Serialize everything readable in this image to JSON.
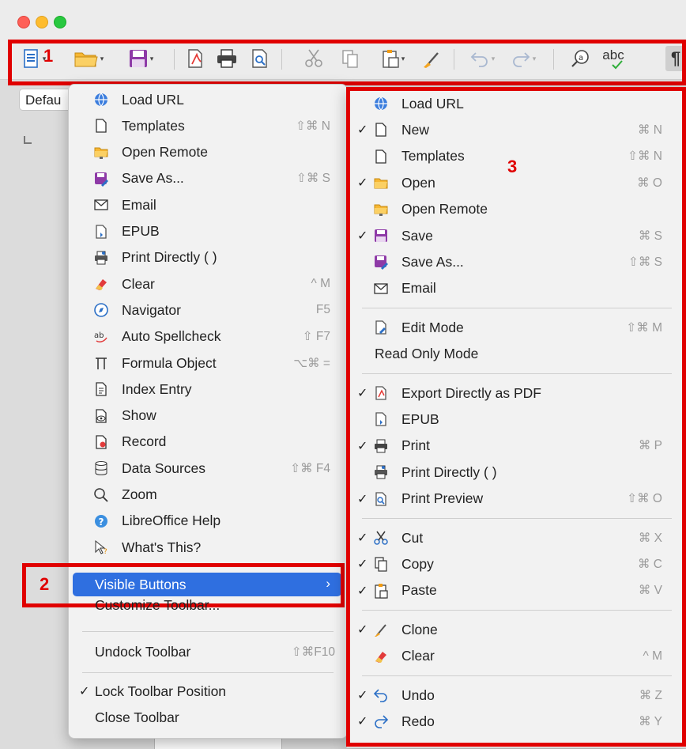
{
  "window": {
    "traffic_lights": [
      "close",
      "minimize",
      "zoom"
    ]
  },
  "annotations": {
    "one": "1",
    "two": "2",
    "three": "3"
  },
  "background": {
    "paragraph_style": "Defau"
  },
  "toolbar": {
    "icons": [
      "new-document-icon",
      "open-folder-icon",
      "save-icon",
      "export-pdf-icon",
      "print-icon",
      "print-preview-icon",
      "cut-icon",
      "copy-icon",
      "paste-icon",
      "clone-formatting-icon",
      "undo-icon",
      "redo-icon",
      "find-replace-icon",
      "spellcheck-icon",
      "formatting-marks-icon"
    ],
    "spellcheck_text": "abc",
    "pilcrow": "¶"
  },
  "context_menu": {
    "items": [
      {
        "label": "Load URL",
        "icon": "globe-icon",
        "shortcut": ""
      },
      {
        "label": "Templates",
        "icon": "document-icon",
        "shortcut": "⇧⌘ N"
      },
      {
        "label": "Open Remote",
        "icon": "remote-folder-icon",
        "shortcut": ""
      },
      {
        "label": "Save As...",
        "icon": "save-as-icon",
        "shortcut": "⇧⌘ S"
      },
      {
        "label": "Email",
        "icon": "envelope-icon",
        "shortcut": ""
      },
      {
        "label": "EPUB",
        "icon": "epub-icon",
        "shortcut": ""
      },
      {
        "label": "Print Directly ( )",
        "icon": "print-directly-icon",
        "shortcut": ""
      },
      {
        "label": "Clear",
        "icon": "eraser-icon",
        "shortcut": "^ M"
      },
      {
        "label": "Navigator",
        "icon": "compass-icon",
        "shortcut": "F5"
      },
      {
        "label": "Auto Spellcheck",
        "icon": "auto-spellcheck-icon",
        "shortcut": "⇧ F7"
      },
      {
        "label": "Formula Object",
        "icon": "formula-icon",
        "shortcut": "⌥⌘ ="
      },
      {
        "label": "Index Entry",
        "icon": "index-entry-icon",
        "shortcut": ""
      },
      {
        "label": "Show",
        "icon": "show-changes-icon",
        "shortcut": ""
      },
      {
        "label": "Record",
        "icon": "record-changes-icon",
        "shortcut": ""
      },
      {
        "label": "Data Sources",
        "icon": "database-icon",
        "shortcut": "⇧⌘ F4"
      },
      {
        "label": "Zoom",
        "icon": "magnifier-icon",
        "shortcut": ""
      },
      {
        "label": "LibreOffice Help",
        "icon": "help-icon",
        "shortcut": ""
      },
      {
        "label": "What's This?",
        "icon": "whats-this-icon",
        "shortcut": ""
      }
    ],
    "visible_buttons": "Visible Buttons",
    "customize_toolbar": "Customize Toolbar...",
    "undock_toolbar": "Undock Toolbar",
    "undock_shortcut": "⇧⌘F10",
    "lock_toolbar_position": "Lock Toolbar Position",
    "close_toolbar": "Close Toolbar"
  },
  "visible_buttons_menu": {
    "groups": [
      [
        {
          "label": "Load URL",
          "icon": "globe-icon",
          "checked": false,
          "shortcut": ""
        },
        {
          "label": "New",
          "icon": "document-icon",
          "checked": true,
          "shortcut": "⌘ N"
        },
        {
          "label": "Templates",
          "icon": "document-icon",
          "checked": false,
          "shortcut": "⇧⌘ N"
        },
        {
          "label": "Open",
          "icon": "open-folder-icon",
          "checked": true,
          "shortcut": "⌘ O"
        },
        {
          "label": "Open Remote",
          "icon": "remote-folder-icon",
          "checked": false,
          "shortcut": ""
        },
        {
          "label": "Save",
          "icon": "save-icon",
          "checked": true,
          "shortcut": "⌘ S"
        },
        {
          "label": "Save As...",
          "icon": "save-as-icon",
          "checked": false,
          "shortcut": "⇧⌘ S"
        },
        {
          "label": "Email",
          "icon": "envelope-icon",
          "checked": false,
          "shortcut": ""
        }
      ],
      [
        {
          "label": "Edit Mode",
          "icon": "edit-mode-icon",
          "checked": false,
          "shortcut": "⇧⌘ M"
        },
        {
          "label": "Read Only Mode",
          "icon": "",
          "checked": false,
          "shortcut": ""
        }
      ],
      [
        {
          "label": "Export Directly as PDF",
          "icon": "export-pdf-icon",
          "checked": true,
          "shortcut": ""
        },
        {
          "label": "EPUB",
          "icon": "epub-icon",
          "checked": false,
          "shortcut": ""
        },
        {
          "label": "Print",
          "icon": "print-icon",
          "checked": true,
          "shortcut": "⌘ P"
        },
        {
          "label": "Print Directly ( )",
          "icon": "print-directly-icon",
          "checked": false,
          "shortcut": ""
        },
        {
          "label": "Print Preview",
          "icon": "print-preview-icon",
          "checked": true,
          "shortcut": "⇧⌘ O"
        }
      ],
      [
        {
          "label": "Cut",
          "icon": "cut-icon",
          "checked": true,
          "shortcut": "⌘ X"
        },
        {
          "label": "Copy",
          "icon": "copy-icon",
          "checked": true,
          "shortcut": "⌘ C"
        },
        {
          "label": "Paste",
          "icon": "paste-icon",
          "checked": true,
          "shortcut": "⌘ V"
        }
      ],
      [
        {
          "label": "Clone",
          "icon": "clone-formatting-icon",
          "checked": true,
          "shortcut": ""
        },
        {
          "label": "Clear",
          "icon": "eraser-icon",
          "checked": false,
          "shortcut": "^ M"
        }
      ],
      [
        {
          "label": "Undo",
          "icon": "undo-icon",
          "checked": true,
          "shortcut": "⌘ Z"
        },
        {
          "label": "Redo",
          "icon": "redo-icon",
          "checked": true,
          "shortcut": "⌘ Y"
        }
      ]
    ]
  },
  "colors": {
    "highlight": "#2f6fe0",
    "annotation_red": "#e00000"
  }
}
